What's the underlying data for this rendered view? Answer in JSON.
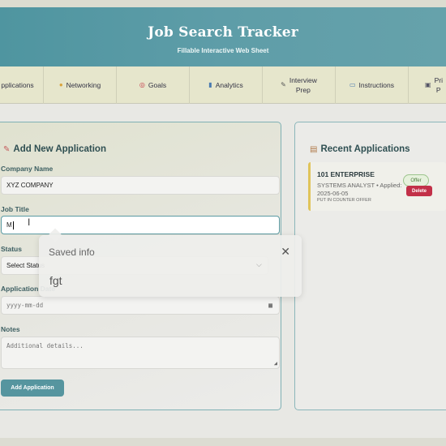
{
  "header": {
    "title": "Job Search Tracker",
    "subtitle": "Fillable Interactive Web Sheet"
  },
  "nav": {
    "items": [
      {
        "icon": "",
        "label": "pplications"
      },
      {
        "icon": "●",
        "label": "Networking"
      },
      {
        "icon": "◎",
        "label": "Goals"
      },
      {
        "icon": "▮",
        "label": "Analytics"
      },
      {
        "icon": "✎",
        "label": "Interview",
        "label2": "Prep"
      },
      {
        "icon": "▭",
        "label": "Instructions"
      },
      {
        "icon": "▣",
        "label": "Pri",
        "label2": "P"
      }
    ]
  },
  "form": {
    "title": "Add New Application",
    "company_label": "Company Name",
    "company_value": "XYZ COMPANY",
    "job_label": "Job Title",
    "job_value": "M",
    "status_label": "Status",
    "status_value": "Select Status",
    "date_label": "Application Date",
    "date_placeholder": "yyyy-mm-dd",
    "notes_label": "Notes",
    "notes_placeholder": "Additional details...",
    "add_button": "Add Application"
  },
  "recent": {
    "title": "Recent Applications",
    "item": {
      "company": "101 ENTERPRISE",
      "role_line": "SYSTEMS ANALYST • Applied: 2025-06-05",
      "note": "PUT IN COUNTER OFFER",
      "status": "Offer",
      "delete_label": "Delete"
    }
  },
  "autofill": {
    "title": "Saved info",
    "suggestion": "fgt",
    "close": "✕"
  }
}
